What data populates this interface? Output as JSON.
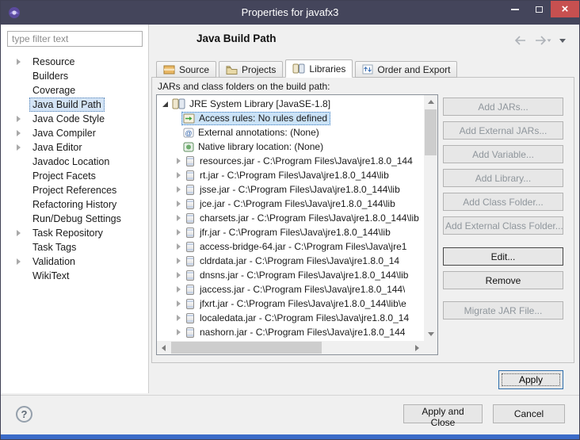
{
  "window": {
    "title": "Properties for javafx3"
  },
  "glyphs": {
    "close": "×",
    "help": "?"
  },
  "icons": {
    "app": "eclipse-logo-icon",
    "titlebar": [
      "minimize-icon",
      "maximize-icon",
      "close-icon"
    ],
    "header_nav": [
      "back-arrow-icon",
      "forward-arrow-icon",
      "view-menu-icon"
    ],
    "tabs": [
      "package-icon",
      "folder-icon",
      "jar-stack-icon",
      "order-icon"
    ],
    "tree": [
      "library-icon",
      "access-rules-icon",
      "annotation-icon",
      "native-library-icon",
      "jar-file-icon"
    ]
  },
  "colors": {
    "titlebar": "#44455b",
    "close_button": "#c75050",
    "selection": "#cbe3f7",
    "focus_accent": "#2f6fad",
    "taskbar_strip": "#3a6bc8"
  },
  "sidebar": {
    "filter_placeholder": "type filter text",
    "items": [
      {
        "label": "Resource",
        "expandable": true
      },
      {
        "label": "Builders",
        "expandable": false
      },
      {
        "label": "Coverage",
        "expandable": false
      },
      {
        "label": "Java Build Path",
        "expandable": false,
        "selected": true
      },
      {
        "label": "Java Code Style",
        "expandable": true
      },
      {
        "label": "Java Compiler",
        "expandable": true
      },
      {
        "label": "Java Editor",
        "expandable": true
      },
      {
        "label": "Javadoc Location",
        "expandable": false
      },
      {
        "label": "Project Facets",
        "expandable": false
      },
      {
        "label": "Project References",
        "expandable": false
      },
      {
        "label": "Refactoring History",
        "expandable": false
      },
      {
        "label": "Run/Debug Settings",
        "expandable": false
      },
      {
        "label": "Task Repository",
        "expandable": true
      },
      {
        "label": "Task Tags",
        "expandable": false
      },
      {
        "label": "Validation",
        "expandable": true
      },
      {
        "label": "WikiText",
        "expandable": false
      }
    ]
  },
  "header": {
    "title": "Java Build Path"
  },
  "tabs": [
    {
      "label": "Source",
      "selected": false
    },
    {
      "label": "Projects",
      "selected": false
    },
    {
      "label": "Libraries",
      "selected": true
    },
    {
      "label": "Order and Export",
      "selected": false
    }
  ],
  "content": {
    "list_label": "JARs and class folders on the build path:",
    "tree": {
      "root_label": "JRE System Library [JavaSE-1.8]",
      "entries": [
        {
          "label": "Access rules: No rules defined",
          "selected": true
        },
        {
          "label": "External annotations: (None)",
          "selected": false
        },
        {
          "label": "Native library location: (None)",
          "selected": false
        },
        {
          "label": "resources.jar - C:\\Program Files\\Java\\jre1.8.0_144",
          "selected": false
        },
        {
          "label": "rt.jar - C:\\Program Files\\Java\\jre1.8.0_144\\lib",
          "selected": false
        },
        {
          "label": "jsse.jar - C:\\Program Files\\Java\\jre1.8.0_144\\lib",
          "selected": false
        },
        {
          "label": "jce.jar - C:\\Program Files\\Java\\jre1.8.0_144\\lib",
          "selected": false
        },
        {
          "label": "charsets.jar - C:\\Program Files\\Java\\jre1.8.0_144\\lib",
          "selected": false
        },
        {
          "label": "jfr.jar - C:\\Program Files\\Java\\jre1.8.0_144\\lib",
          "selected": false
        },
        {
          "label": "access-bridge-64.jar - C:\\Program Files\\Java\\jre1",
          "selected": false
        },
        {
          "label": "cldrdata.jar - C:\\Program Files\\Java\\jre1.8.0_14",
          "selected": false
        },
        {
          "label": "dnsns.jar - C:\\Program Files\\Java\\jre1.8.0_144\\lib",
          "selected": false
        },
        {
          "label": "jaccess.jar - C:\\Program Files\\Java\\jre1.8.0_144\\",
          "selected": false
        },
        {
          "label": "jfxrt.jar - C:\\Program Files\\Java\\jre1.8.0_144\\lib\\e",
          "selected": false
        },
        {
          "label": "localedata.jar - C:\\Program Files\\Java\\jre1.8.0_14",
          "selected": false
        },
        {
          "label": "nashorn.jar - C:\\Program Files\\Java\\jre1.8.0_144",
          "selected": false
        }
      ]
    }
  },
  "actions": [
    {
      "label": "Add JARs...",
      "enabled": false
    },
    {
      "label": "Add External JARs...",
      "enabled": false
    },
    {
      "label": "Add Variable...",
      "enabled": false
    },
    {
      "label": "Add Library...",
      "enabled": false
    },
    {
      "label": "Add Class Folder...",
      "enabled": false
    },
    {
      "label": "Add External Class Folder...",
      "enabled": false
    },
    {
      "label": "Edit...",
      "enabled": true
    },
    {
      "label": "Remove",
      "enabled": true
    },
    {
      "label": "Migrate JAR File...",
      "enabled": false
    }
  ],
  "footer": {
    "apply": "Apply",
    "apply_and_close": "Apply and Close",
    "cancel": "Cancel"
  }
}
